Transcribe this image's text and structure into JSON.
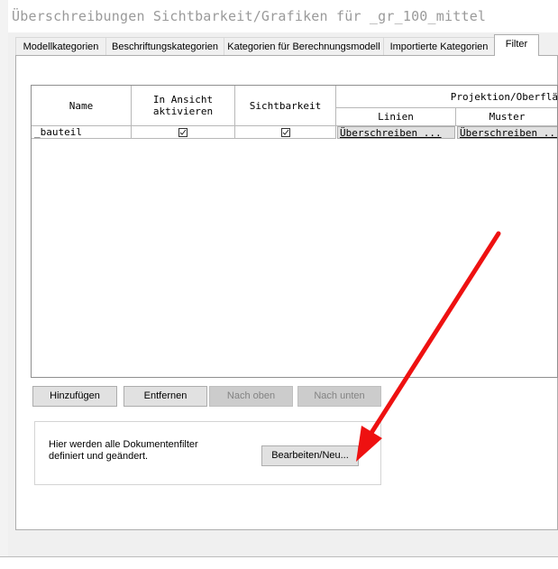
{
  "dialog": {
    "title": "Überschreibungen Sichtbarkeit/Grafiken für _gr_100_mittel"
  },
  "tabs": [
    {
      "label": "Modellkategorien"
    },
    {
      "label": "Beschriftungskategorien"
    },
    {
      "label": "Kategorien für Berechnungsmodell"
    },
    {
      "label": "Importierte Kategorien"
    },
    {
      "label": "Filter",
      "active": true
    }
  ],
  "table": {
    "headers": {
      "name": "Name",
      "activate": "In Ansicht\naktivieren",
      "visibility": "Sichtbarkeit",
      "projection_group": "Projektion/Oberflä",
      "lines": "Linien",
      "pattern": "Muster"
    },
    "rows": [
      {
        "name": "_bauteil",
        "activate": true,
        "visible": true,
        "lines": "Überschreiben ...",
        "pattern": "Überschreiben ..."
      }
    ]
  },
  "buttons": {
    "add": "Hinzufügen",
    "remove": "Entfernen",
    "up": "Nach oben",
    "down": "Nach unten",
    "edit_new": "Bearbeiten/Neu..."
  },
  "filter_box": {
    "description": "Hier werden alle Dokumentenfilter definiert und geändert."
  },
  "colors": {
    "annotation_arrow": "#ee1111",
    "dialog_bg": "#f0f0f0",
    "disabled_button": "#cccccc"
  }
}
